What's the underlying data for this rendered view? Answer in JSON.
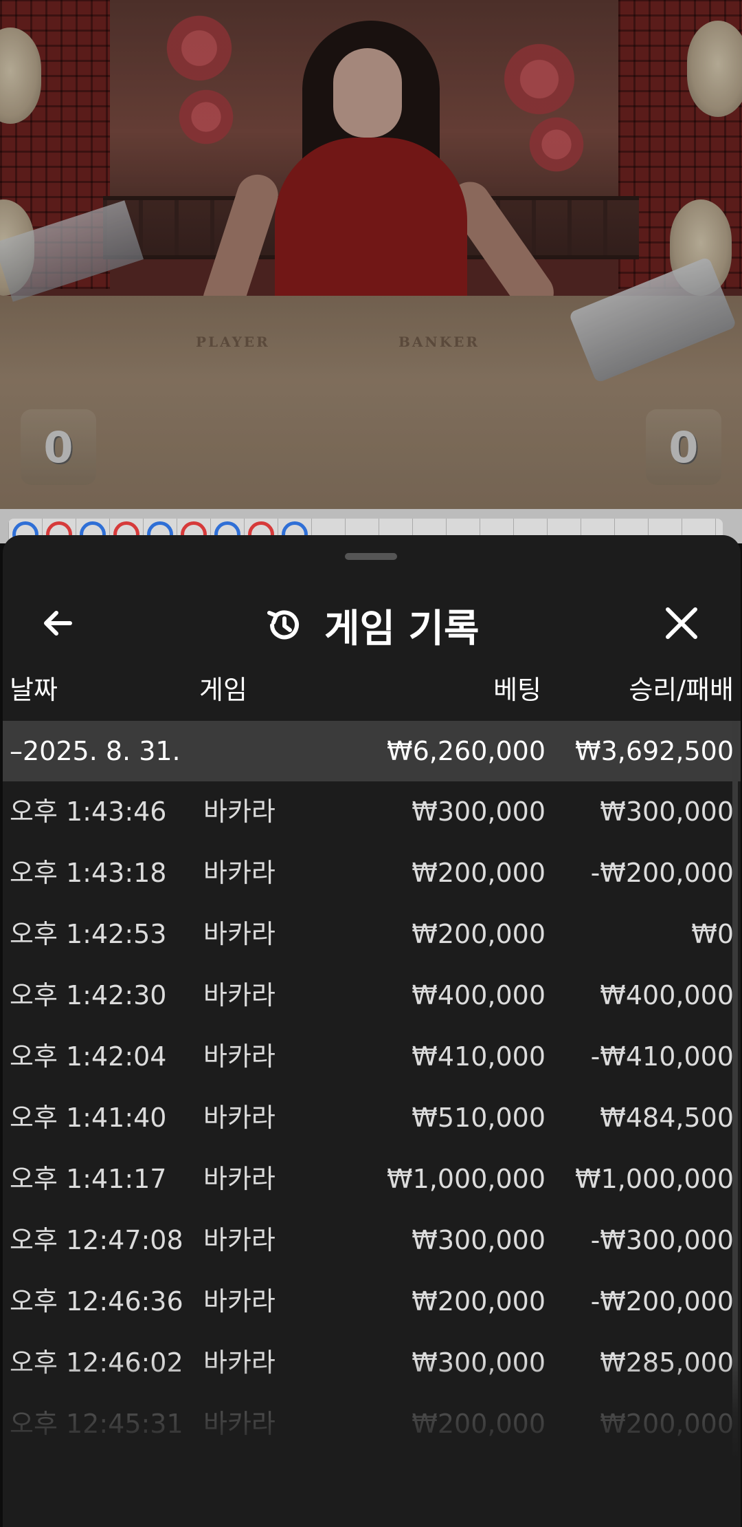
{
  "stage": {
    "player_label": "PLAYER",
    "banker_label": "BANKER",
    "player_score": "0",
    "banker_score": "0"
  },
  "roadmap": {
    "beads": [
      "blue",
      "red",
      "blue",
      "red",
      "blue",
      "red",
      "blue",
      "red",
      "blue"
    ]
  },
  "sheet": {
    "title": "게임 기록",
    "back_icon": "arrow-left-icon",
    "history_icon": "history-icon",
    "close_icon": "close-icon",
    "columns": {
      "date": "날짜",
      "game": "게임",
      "bet": "베팅",
      "result": "승리/패배"
    },
    "summary": {
      "date": "–2025. 8. 31.",
      "bet": "₩6,260,000",
      "result": "₩3,692,500"
    },
    "rows": [
      {
        "time": "오후 1:43:46",
        "game": "바카라",
        "bet": "₩300,000",
        "result": "₩300,000"
      },
      {
        "time": "오후 1:43:18",
        "game": "바카라",
        "bet": "₩200,000",
        "result": "-₩200,000"
      },
      {
        "time": "오후 1:42:53",
        "game": "바카라",
        "bet": "₩200,000",
        "result": "₩0"
      },
      {
        "time": "오후 1:42:30",
        "game": "바카라",
        "bet": "₩400,000",
        "result": "₩400,000"
      },
      {
        "time": "오후 1:42:04",
        "game": "바카라",
        "bet": "₩410,000",
        "result": "-₩410,000"
      },
      {
        "time": "오후 1:41:40",
        "game": "바카라",
        "bet": "₩510,000",
        "result": "₩484,500"
      },
      {
        "time": "오후 1:41:17",
        "game": "바카라",
        "bet": "₩1,000,000",
        "result": "₩1,000,000"
      },
      {
        "time": "오후 12:47:08",
        "game": "바카라",
        "bet": "₩300,000",
        "result": "-₩300,000"
      },
      {
        "time": "오후 12:46:36",
        "game": "바카라",
        "bet": "₩200,000",
        "result": "-₩200,000"
      },
      {
        "time": "오후 12:46:02",
        "game": "바카라",
        "bet": "₩300,000",
        "result": "₩285,000"
      },
      {
        "time": "오후 12:45:31",
        "game": "바카라",
        "bet": "₩200,000",
        "result": "₩200,000"
      }
    ]
  }
}
